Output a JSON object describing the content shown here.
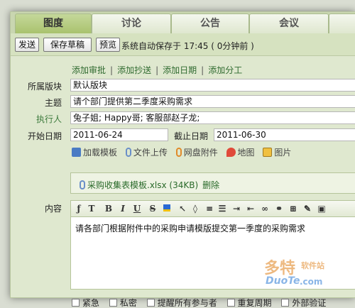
{
  "tabs": [
    {
      "label": "图度",
      "active": true
    },
    {
      "label": "讨论",
      "active": false
    },
    {
      "label": "公告",
      "active": false
    },
    {
      "label": "会议",
      "active": false
    }
  ],
  "toolbar": {
    "send_label": "发送",
    "save_draft_label": "保存草稿",
    "preview_label": "预览",
    "autosave_text": "系统自动保存于 17:45 ( 0分钟前 )"
  },
  "links": {
    "add_approval": "添加审批",
    "add_cc": "添加抄送",
    "add_date": "添加日期",
    "add_division": "添加分工",
    "separator": "|"
  },
  "form": {
    "board_label": "所属版块",
    "board_value": "默认版块",
    "subject_label": "主题",
    "subject_value": "请个部门提供第二季度采购需求",
    "executor_label": "执行人",
    "executor_value": "兔子姐; Happy哥; 客服部赵子龙;",
    "start_label": "开始日期",
    "start_value": "2011-06-24",
    "end_label": "截止日期",
    "end_value": "2011-06-30",
    "content_label": "内容"
  },
  "attach_tools": {
    "load_template": "加载模板",
    "file_upload": "文件上传",
    "netdisk_attach": "网盘附件",
    "map": "地图",
    "image": "图片"
  },
  "attachment": {
    "filename": "采购收集表模板.xlsx (34KB)",
    "delete_label": "删除"
  },
  "editor": {
    "content": "请各部门根据附件中的采购申请模版提交第一季度的采购需求",
    "tools": [
      "clear-format",
      "text-format",
      "bold",
      "italic",
      "underline",
      "strikethrough",
      "fill-color",
      "pointer",
      "eraser",
      "align",
      "list",
      "indent",
      "outdent",
      "link",
      "unlink",
      "edit",
      "source"
    ],
    "bold_glyph": "B",
    "italic_glyph": "I",
    "underline_glyph": "U",
    "strike_glyph": "S"
  },
  "options": [
    {
      "label": "紧急",
      "checked": false
    },
    {
      "label": "私密",
      "checked": false
    },
    {
      "label": "提醒所有参与者",
      "checked": false
    },
    {
      "label": "重复周期",
      "checked": false
    },
    {
      "label": "外部验证",
      "checked": false
    }
  ],
  "watermark": {
    "brand_cn": "多特",
    "brand_sub": "软件站",
    "brand_en": "DuoTe",
    "domain": ".com"
  },
  "colors": {
    "accent_green": "#3c7a3c",
    "tab_active": "#b3c97f",
    "panel_bg": "#dfe8cf"
  }
}
